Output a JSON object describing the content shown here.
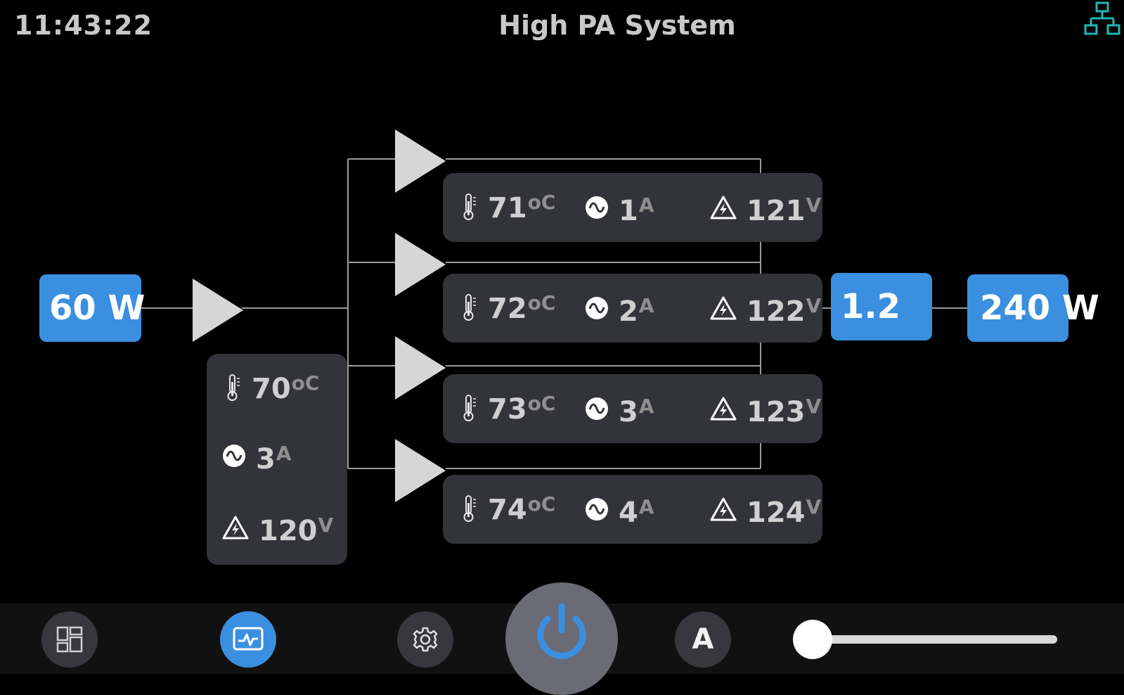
{
  "header": {
    "time": "11:43:22",
    "title": "High PA System",
    "network_icon": "network-topology-icon"
  },
  "colors": {
    "accent": "#3b8fe0",
    "network_icon": "#1fb6b6",
    "panel": "#33333a",
    "background": "#000000"
  },
  "input_power": "60 W",
  "output_power": "240 W",
  "combiner_value": "1.2",
  "driver_stage": {
    "temperature": "70",
    "temperature_unit": "oC",
    "current": "3",
    "current_unit": "A",
    "voltage": "120",
    "voltage_unit": "V"
  },
  "pa_stages": [
    {
      "temperature": "71",
      "temperature_unit": "oC",
      "current": "1",
      "current_unit": "A",
      "voltage": "121",
      "voltage_unit": "V"
    },
    {
      "temperature": "72",
      "temperature_unit": "oC",
      "current": "2",
      "current_unit": "A",
      "voltage": "122",
      "voltage_unit": "V"
    },
    {
      "temperature": "73",
      "temperature_unit": "oC",
      "current": "3",
      "current_unit": "A",
      "voltage": "123",
      "voltage_unit": "V"
    },
    {
      "temperature": "74",
      "temperature_unit": "oC",
      "current": "4",
      "current_unit": "A",
      "voltage": "124",
      "voltage_unit": "V"
    }
  ],
  "bottom_bar": {
    "buttons": [
      "dashboard-layout-icon",
      "monitor-pulse-icon",
      "gear-icon",
      "power-icon"
    ],
    "active": "monitor-pulse-icon",
    "auto_label": "A",
    "slider_level": 0
  }
}
